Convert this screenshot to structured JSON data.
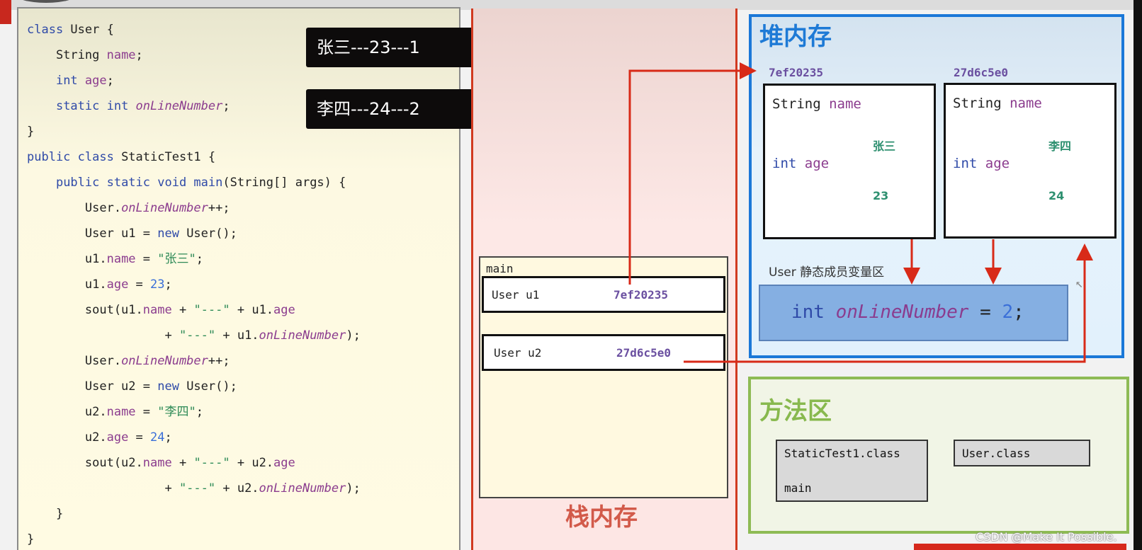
{
  "code": {
    "lines": [
      [
        {
          "t": "class ",
          "c": "kw"
        },
        {
          "t": "User {",
          "c": ""
        }
      ],
      [
        {
          "t": "    String ",
          "c": ""
        },
        {
          "t": "name",
          "c": "fld"
        },
        {
          "t": ";",
          "c": ""
        }
      ],
      [
        {
          "t": "    ",
          "c": ""
        },
        {
          "t": "int ",
          "c": "kw"
        },
        {
          "t": "age",
          "c": "fld"
        },
        {
          "t": ";",
          "c": ""
        }
      ],
      [
        {
          "t": "    ",
          "c": ""
        },
        {
          "t": "static int ",
          "c": "kw"
        },
        {
          "t": "onLineNumber",
          "c": "it"
        },
        {
          "t": ";",
          "c": ""
        }
      ],
      [
        {
          "t": "}",
          "c": ""
        }
      ],
      [
        {
          "t": "public class ",
          "c": "kw"
        },
        {
          "t": "StaticTest1 {",
          "c": ""
        }
      ],
      [
        {
          "t": "    ",
          "c": ""
        },
        {
          "t": "public static void ",
          "c": "kw"
        },
        {
          "t": "main",
          "c": "kw"
        },
        {
          "t": "(String[] args) {",
          "c": ""
        }
      ],
      [
        {
          "t": "        User.",
          "c": ""
        },
        {
          "t": "onLineNumber",
          "c": "it"
        },
        {
          "t": "++;",
          "c": ""
        }
      ],
      [
        {
          "t": "        User u1 = ",
          "c": ""
        },
        {
          "t": "new ",
          "c": "kw"
        },
        {
          "t": "User();",
          "c": ""
        }
      ],
      [
        {
          "t": "        u1.",
          "c": ""
        },
        {
          "t": "name",
          "c": "fld"
        },
        {
          "t": " = ",
          "c": ""
        },
        {
          "t": "\"张三\"",
          "c": "str"
        },
        {
          "t": ";",
          "c": ""
        }
      ],
      [
        {
          "t": "        u1.",
          "c": ""
        },
        {
          "t": "age",
          "c": "fld"
        },
        {
          "t": " = ",
          "c": ""
        },
        {
          "t": "23",
          "c": "num"
        },
        {
          "t": ";",
          "c": ""
        }
      ],
      [
        {
          "t": "        sout(u1.",
          "c": ""
        },
        {
          "t": "name",
          "c": "fld"
        },
        {
          "t": " + ",
          "c": ""
        },
        {
          "t": "\"---\"",
          "c": "str"
        },
        {
          "t": " + u1.",
          "c": ""
        },
        {
          "t": "age",
          "c": "fld"
        }
      ],
      [
        {
          "t": "                   + ",
          "c": ""
        },
        {
          "t": "\"---\"",
          "c": "str"
        },
        {
          "t": " + u1.",
          "c": ""
        },
        {
          "t": "onLineNumber",
          "c": "it"
        },
        {
          "t": ");",
          "c": ""
        }
      ],
      [
        {
          "t": "        User.",
          "c": ""
        },
        {
          "t": "onLineNumber",
          "c": "it"
        },
        {
          "t": "++;",
          "c": ""
        }
      ],
      [
        {
          "t": "        User u2 = ",
          "c": ""
        },
        {
          "t": "new ",
          "c": "kw"
        },
        {
          "t": "User();",
          "c": ""
        }
      ],
      [
        {
          "t": "        u2.",
          "c": ""
        },
        {
          "t": "name",
          "c": "fld"
        },
        {
          "t": " = ",
          "c": ""
        },
        {
          "t": "\"李四\"",
          "c": "str"
        },
        {
          "t": ";",
          "c": ""
        }
      ],
      [
        {
          "t": "        u2.",
          "c": ""
        },
        {
          "t": "age",
          "c": "fld"
        },
        {
          "t": " = ",
          "c": ""
        },
        {
          "t": "24",
          "c": "num"
        },
        {
          "t": ";",
          "c": ""
        }
      ],
      [
        {
          "t": "        sout(u2.",
          "c": ""
        },
        {
          "t": "name",
          "c": "fld"
        },
        {
          "t": " + ",
          "c": ""
        },
        {
          "t": "\"---\"",
          "c": "str"
        },
        {
          "t": " + u2.",
          "c": ""
        },
        {
          "t": "age",
          "c": "fld"
        }
      ],
      [
        {
          "t": "                   + ",
          "c": ""
        },
        {
          "t": "\"---\"",
          "c": "str"
        },
        {
          "t": " + u2.",
          "c": ""
        },
        {
          "t": "onLineNumber",
          "c": "it"
        },
        {
          "t": ");",
          "c": ""
        }
      ],
      [
        {
          "t": "    }",
          "c": ""
        }
      ],
      [
        {
          "t": "}",
          "c": ""
        }
      ]
    ]
  },
  "outputs": [
    "张三---23---1",
    "李四---24---2"
  ],
  "stack": {
    "title": "栈内存",
    "frame_name": "main",
    "vars": [
      {
        "name": "User u1",
        "addr": "7ef20235"
      },
      {
        "name": "User u2",
        "addr": "27d6c5e0"
      }
    ]
  },
  "heap": {
    "title": "堆内存",
    "objects": [
      {
        "addr": "7ef20235",
        "field1_type": "String",
        "field1_name": "name",
        "field1_value": "张三",
        "field2_type": "int",
        "field2_name": "age",
        "field2_value": "23"
      },
      {
        "addr": "27d6c5e0",
        "field1_type": "String",
        "field1_name": "name",
        "field1_value": "李四",
        "field2_type": "int",
        "field2_name": "age",
        "field2_value": "24"
      }
    ],
    "static_area_label": "User 静态成员变量区",
    "static_var": {
      "type": "int",
      "name": "onLineNumber",
      "op": " = ",
      "value": "2",
      "end": ";"
    }
  },
  "method_area": {
    "title": "方法区",
    "classes": [
      {
        "name": "StaticTest1.class",
        "method": "main"
      },
      {
        "name": "User.class"
      }
    ]
  },
  "watermark": "CSDN @Make It Possible.",
  "colors": {
    "arrow": "#d82a18",
    "heap_border": "#1b78d8",
    "method_border": "#8ebb55",
    "stack_title": "#d25a4a"
  }
}
